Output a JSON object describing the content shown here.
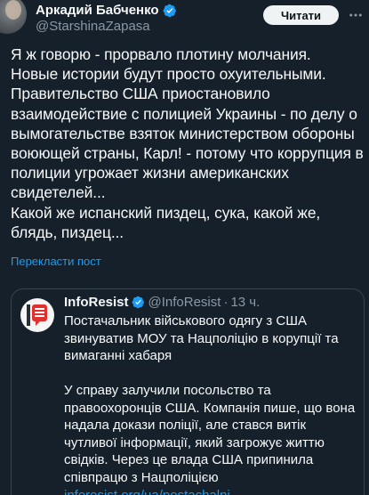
{
  "author": {
    "name": "Аркадий Бабченко",
    "handle": "@StarshinaZapasa"
  },
  "follow_label": "Читати",
  "tweet": {
    "text": "Я ж говорю - прорвало плотину молчания.\nНовые истории будут просто охуительными.\nПравительство США приостановило взаимодействие с полицией Украины - по делу о вымогательстве взяток министерством обороны воюющей страны, Карл! - потому что коррупция в полиции угрожает жизни американских свидетелей...\nКакой же испанский пиздец, сука, какой же, блядь, пиздец...",
    "translate_label": "Перекласти пост"
  },
  "quote": {
    "name": "InfoResist",
    "handle": "@InfoResist",
    "separator": "·",
    "time": "13 ч.",
    "title": "Постачальник військового одягу з США звинуватив МОУ та Нацполіцію в корупції та вимаганні хабаря",
    "body": "У справу залучили посольство та правоохоронців США. Компанія пише, що вона надала докази поліції, але стався витік чутливої інформації, який загрожує життю свідків. Через це влада США припинила співпрацю з Нацполіцією ",
    "link": "inforesist.org/ua/postachalni..."
  },
  "colors": {
    "background": "#15202b",
    "accent": "#1d9bf0",
    "verified": "#1d9bf0",
    "secondary_text": "#8b98a5"
  },
  "icons": {
    "verified": "verified-badge-icon",
    "more": "more-dots-icon",
    "quote_logo": "inforesist-logo-icon"
  }
}
